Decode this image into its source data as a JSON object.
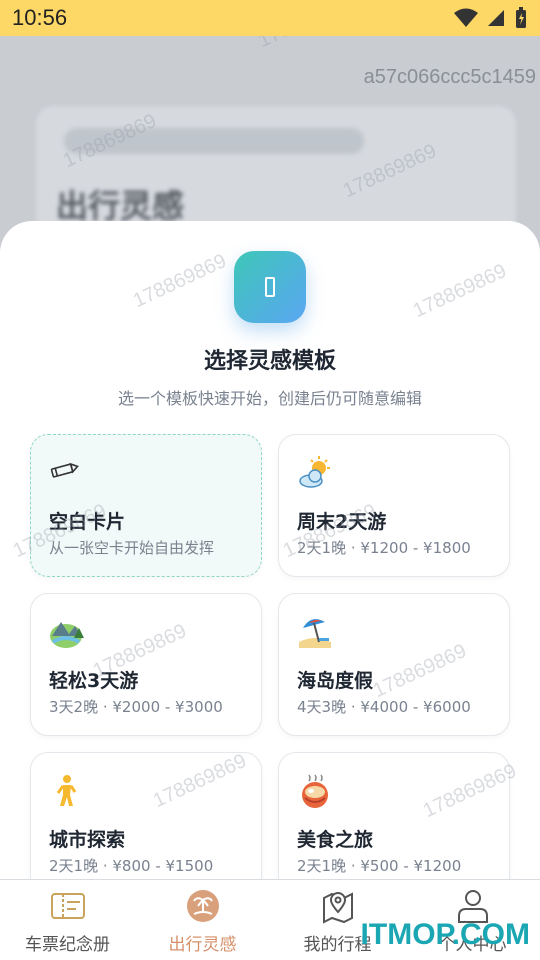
{
  "status_bar": {
    "time": "10:56"
  },
  "overlay_id": "a57c066ccc5c1459",
  "background_page": {
    "title": "出行灵感"
  },
  "watermark_text": "178869869",
  "sheet": {
    "title": "选择灵感模板",
    "subtitle": "选一个模板快速开始，创建后仍可随意编辑",
    "templates": [
      {
        "icon": "pencil-icon",
        "title": "空白卡片",
        "desc": "从一张空卡开始自由发挥",
        "selected": true
      },
      {
        "icon": "sun-cloud-icon",
        "title": "周末2天游",
        "desc": "2天1晚 · ¥1200 - ¥1800",
        "selected": false
      },
      {
        "icon": "landscape-icon",
        "title": "轻松3天游",
        "desc": "3天2晚 · ¥2000 - ¥3000",
        "selected": false
      },
      {
        "icon": "beach-umbrella-icon",
        "title": "海岛度假",
        "desc": "4天3晚 · ¥4000 - ¥6000",
        "selected": false
      },
      {
        "icon": "walking-person-icon",
        "title": "城市探索",
        "desc": "2天1晚 · ¥800 - ¥1500",
        "selected": false
      },
      {
        "icon": "food-bowl-icon",
        "title": "美食之旅",
        "desc": "2天1晚 · ¥500 - ¥1200",
        "selected": false
      }
    ]
  },
  "bottom_nav": [
    {
      "icon": "ticket-icon",
      "label": "车票纪念册",
      "active": false
    },
    {
      "icon": "palm-island-icon",
      "label": "出行灵感",
      "active": true
    },
    {
      "icon": "map-pin-icon",
      "label": "我的行程",
      "active": false
    },
    {
      "icon": "person-icon",
      "label": "个人中心",
      "active": false
    }
  ],
  "corner_watermark": "ITMOP.COM",
  "colors": {
    "status_bar": "#fdd866",
    "active_nav": "#d5906a",
    "accent_gradient_start": "#3ec7b8",
    "accent_gradient_end": "#5aa6f2"
  }
}
